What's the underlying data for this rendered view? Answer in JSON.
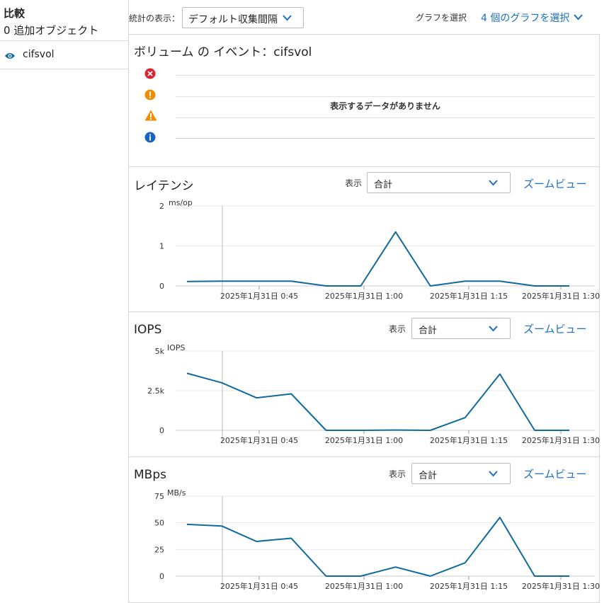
{
  "sidebar": {
    "title": "比較",
    "subtitle": "0 追加オブジェクト",
    "items": [
      {
        "label": "cifsvol",
        "icon": "eye-icon"
      }
    ]
  },
  "toolbar": {
    "stats_label": "統計の表示：",
    "stats_value": "デフォルト収集間隔",
    "graph_label": "グラフを選択",
    "graph_link": "4 個のグラフを選択"
  },
  "events": {
    "title": "ボリューム の イベント：cifsvol",
    "no_data": "表示するデータがありません",
    "icons": [
      "error-icon",
      "critical-icon",
      "warning-icon",
      "info-icon"
    ]
  },
  "colors": {
    "accent": "#1a6fc4",
    "line": "#0f6a9e",
    "error": "#d9232e",
    "critical": "#f08c00",
    "warning": "#f08c00",
    "info": "#1a63c6"
  },
  "charts": [
    {
      "title": "レイテンシ",
      "display_label": "表示",
      "display_value": "合計",
      "zoom_label": "ズームビュー"
    },
    {
      "title": "IOPS",
      "display_label": "表示",
      "display_value": "合計",
      "zoom_label": "ズームビュー"
    },
    {
      "title": "MBps",
      "display_label": "表示",
      "display_value": "合計",
      "zoom_label": "ズームビュー"
    }
  ],
  "chart_data": [
    {
      "type": "line",
      "ylabel": "ms/op",
      "yticks": [
        "2",
        "1",
        "0"
      ],
      "ylim": [
        0,
        2
      ],
      "x_ticks": [
        "2025年1月31日 0:45",
        "2025年1月31日 1:00",
        "2025年1月31日 1:15",
        "2025年1月31日 1:30"
      ],
      "x": [
        "0:40",
        "0:45",
        "0:50",
        "0:55",
        "1:00",
        "1:05",
        "1:10",
        "1:15",
        "1:20",
        "1:25",
        "1:30"
      ],
      "series": [
        {
          "values": [
            0.11,
            0.12,
            0.12,
            0.12,
            0.0,
            0.0,
            1.35,
            0.0,
            0.12,
            0.12,
            0.0,
            0.0
          ]
        }
      ]
    },
    {
      "type": "line",
      "ylabel": "IOPS",
      "yticks": [
        "5k",
        "2.5k",
        "0"
      ],
      "ylim": [
        0,
        5000
      ],
      "x_ticks": [
        "2025年1月31日 0:45",
        "2025年1月31日 1:00",
        "2025年1月31日 1:15",
        "2025年1月31日 1:30"
      ],
      "series": [
        {
          "values": [
            3600,
            3000,
            2050,
            2300,
            0,
            0,
            20,
            0,
            800,
            3550,
            0,
            0
          ]
        }
      ]
    },
    {
      "type": "line",
      "ylabel": "MB/s",
      "yticks": [
        "75",
        "50",
        "25",
        "0"
      ],
      "ylim": [
        0,
        75
      ],
      "x_ticks": [
        "2025年1月31日 0:45",
        "2025年1月31日 1:00",
        "2025年1月31日 1:15",
        "2025年1月31日 1:30"
      ],
      "series": [
        {
          "values": [
            48.5,
            47,
            32.5,
            35.5,
            0,
            0,
            8.5,
            0,
            12.5,
            55,
            0,
            0
          ]
        }
      ]
    }
  ]
}
